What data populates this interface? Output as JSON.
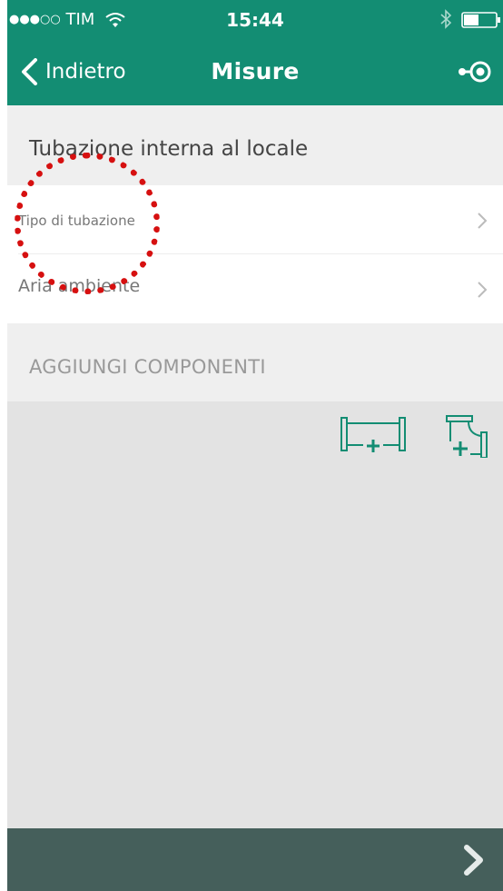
{
  "status_bar": {
    "carrier": "TIM",
    "signal": "●●●○○",
    "time": "15:44",
    "icons": [
      "wifi-icon",
      "bluetooth-icon",
      "battery-icon"
    ]
  },
  "nav": {
    "back_label": "Indietro",
    "title": "Misure",
    "right_icon": "location-target-icon"
  },
  "section": {
    "title": "Tubazione interna al locale"
  },
  "rows": [
    {
      "label": "Tipo di tubazione"
    },
    {
      "label": "Aria ambiente"
    }
  ],
  "add_components": {
    "label": "AGGIUNGI COMPONENTI",
    "buttons": [
      "add-pipe-icon",
      "add-elbow-icon"
    ]
  },
  "footer": {
    "next_icon": "chevron-right-icon"
  },
  "colors": {
    "header": "#138d73",
    "footer": "#455f5b",
    "accent": "#138d73",
    "annotation": "#d61010"
  }
}
